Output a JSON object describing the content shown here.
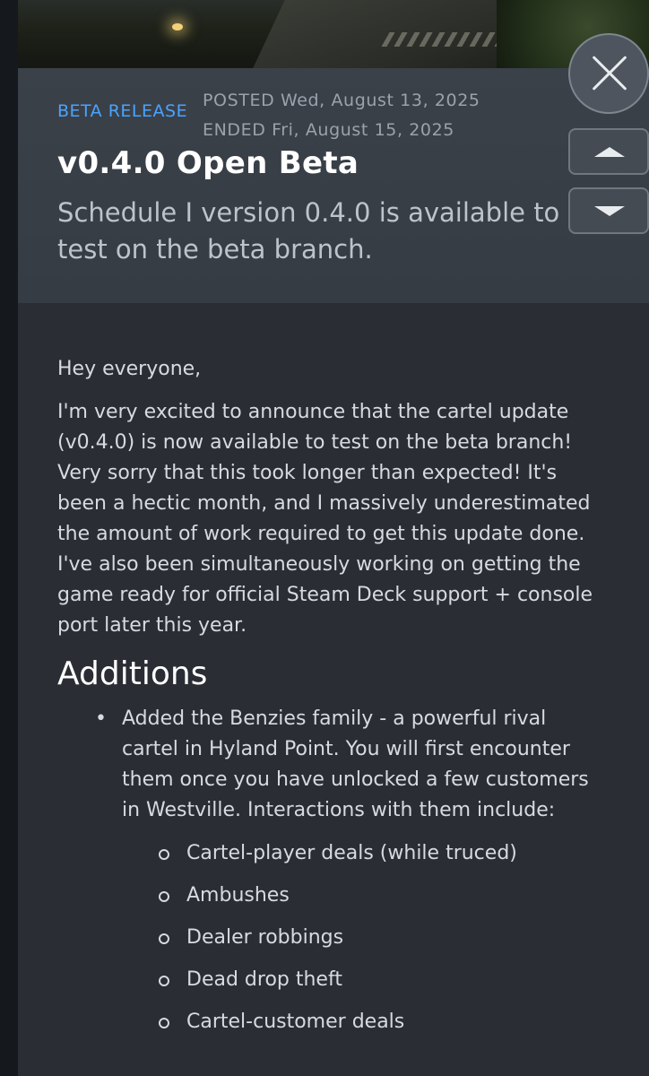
{
  "event": {
    "badge": "BETA RELEASE",
    "posted": "POSTED Wed, August 13, 2025",
    "ended": "ENDED Fri, August 15, 2025",
    "title": "v0.4.0 Open Beta",
    "subtitle_line1": "Schedule I version 0.4.0 is available to",
    "subtitle_line2": "test on the beta branch."
  },
  "body": {
    "greeting": "Hey everyone,",
    "intro": "I'm very excited to announce that the cartel update (v0.4.0) is now available to test on the beta branch! Very sorry that this took longer than expected! It's been a hectic month, and I massively underestimated the amount of work required to get this update done. I've also been simultaneously working on getting the game ready for official Steam Deck support + console port later this year.",
    "section_heading": "Additions",
    "bullet1": "Added the Benzies family - a powerful rival cartel in Hyland Point. You will first encounter them once you have unlocked a few customers in Westville. Interactions with them include:",
    "sub_items": [
      "Cartel-player deals (while truced)",
      "Ambushes",
      "Dealer robbings",
      "Dead drop theft",
      "Cartel-customer deals"
    ]
  },
  "controls": {
    "close_icon": "close-icon",
    "prev_icon": "chevron-up-icon",
    "next_icon": "chevron-down-icon"
  },
  "colors": {
    "accent": "#4aa3ff",
    "header_bg": "#3b4149",
    "body_bg": "#2a2e34"
  }
}
